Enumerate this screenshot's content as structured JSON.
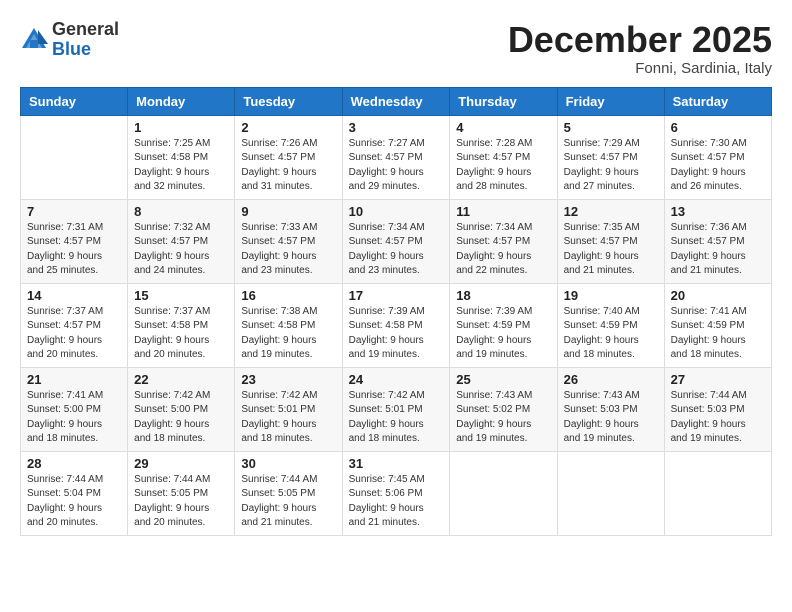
{
  "header": {
    "logo_general": "General",
    "logo_blue": "Blue",
    "title": "December 2025",
    "location": "Fonni, Sardinia, Italy"
  },
  "days_of_week": [
    "Sunday",
    "Monday",
    "Tuesday",
    "Wednesday",
    "Thursday",
    "Friday",
    "Saturday"
  ],
  "weeks": [
    [
      {
        "day": "",
        "info": ""
      },
      {
        "day": "1",
        "info": "Sunrise: 7:25 AM\nSunset: 4:58 PM\nDaylight: 9 hours\nand 32 minutes."
      },
      {
        "day": "2",
        "info": "Sunrise: 7:26 AM\nSunset: 4:57 PM\nDaylight: 9 hours\nand 31 minutes."
      },
      {
        "day": "3",
        "info": "Sunrise: 7:27 AM\nSunset: 4:57 PM\nDaylight: 9 hours\nand 29 minutes."
      },
      {
        "day": "4",
        "info": "Sunrise: 7:28 AM\nSunset: 4:57 PM\nDaylight: 9 hours\nand 28 minutes."
      },
      {
        "day": "5",
        "info": "Sunrise: 7:29 AM\nSunset: 4:57 PM\nDaylight: 9 hours\nand 27 minutes."
      },
      {
        "day": "6",
        "info": "Sunrise: 7:30 AM\nSunset: 4:57 PM\nDaylight: 9 hours\nand 26 minutes."
      }
    ],
    [
      {
        "day": "7",
        "info": "Sunrise: 7:31 AM\nSunset: 4:57 PM\nDaylight: 9 hours\nand 25 minutes."
      },
      {
        "day": "8",
        "info": "Sunrise: 7:32 AM\nSunset: 4:57 PM\nDaylight: 9 hours\nand 24 minutes."
      },
      {
        "day": "9",
        "info": "Sunrise: 7:33 AM\nSunset: 4:57 PM\nDaylight: 9 hours\nand 23 minutes."
      },
      {
        "day": "10",
        "info": "Sunrise: 7:34 AM\nSunset: 4:57 PM\nDaylight: 9 hours\nand 23 minutes."
      },
      {
        "day": "11",
        "info": "Sunrise: 7:34 AM\nSunset: 4:57 PM\nDaylight: 9 hours\nand 22 minutes."
      },
      {
        "day": "12",
        "info": "Sunrise: 7:35 AM\nSunset: 4:57 PM\nDaylight: 9 hours\nand 21 minutes."
      },
      {
        "day": "13",
        "info": "Sunrise: 7:36 AM\nSunset: 4:57 PM\nDaylight: 9 hours\nand 21 minutes."
      }
    ],
    [
      {
        "day": "14",
        "info": "Sunrise: 7:37 AM\nSunset: 4:57 PM\nDaylight: 9 hours\nand 20 minutes."
      },
      {
        "day": "15",
        "info": "Sunrise: 7:37 AM\nSunset: 4:58 PM\nDaylight: 9 hours\nand 20 minutes."
      },
      {
        "day": "16",
        "info": "Sunrise: 7:38 AM\nSunset: 4:58 PM\nDaylight: 9 hours\nand 19 minutes."
      },
      {
        "day": "17",
        "info": "Sunrise: 7:39 AM\nSunset: 4:58 PM\nDaylight: 9 hours\nand 19 minutes."
      },
      {
        "day": "18",
        "info": "Sunrise: 7:39 AM\nSunset: 4:59 PM\nDaylight: 9 hours\nand 19 minutes."
      },
      {
        "day": "19",
        "info": "Sunrise: 7:40 AM\nSunset: 4:59 PM\nDaylight: 9 hours\nand 18 minutes."
      },
      {
        "day": "20",
        "info": "Sunrise: 7:41 AM\nSunset: 4:59 PM\nDaylight: 9 hours\nand 18 minutes."
      }
    ],
    [
      {
        "day": "21",
        "info": "Sunrise: 7:41 AM\nSunset: 5:00 PM\nDaylight: 9 hours\nand 18 minutes."
      },
      {
        "day": "22",
        "info": "Sunrise: 7:42 AM\nSunset: 5:00 PM\nDaylight: 9 hours\nand 18 minutes."
      },
      {
        "day": "23",
        "info": "Sunrise: 7:42 AM\nSunset: 5:01 PM\nDaylight: 9 hours\nand 18 minutes."
      },
      {
        "day": "24",
        "info": "Sunrise: 7:42 AM\nSunset: 5:01 PM\nDaylight: 9 hours\nand 18 minutes."
      },
      {
        "day": "25",
        "info": "Sunrise: 7:43 AM\nSunset: 5:02 PM\nDaylight: 9 hours\nand 19 minutes."
      },
      {
        "day": "26",
        "info": "Sunrise: 7:43 AM\nSunset: 5:03 PM\nDaylight: 9 hours\nand 19 minutes."
      },
      {
        "day": "27",
        "info": "Sunrise: 7:44 AM\nSunset: 5:03 PM\nDaylight: 9 hours\nand 19 minutes."
      }
    ],
    [
      {
        "day": "28",
        "info": "Sunrise: 7:44 AM\nSunset: 5:04 PM\nDaylight: 9 hours\nand 20 minutes."
      },
      {
        "day": "29",
        "info": "Sunrise: 7:44 AM\nSunset: 5:05 PM\nDaylight: 9 hours\nand 20 minutes."
      },
      {
        "day": "30",
        "info": "Sunrise: 7:44 AM\nSunset: 5:05 PM\nDaylight: 9 hours\nand 21 minutes."
      },
      {
        "day": "31",
        "info": "Sunrise: 7:45 AM\nSunset: 5:06 PM\nDaylight: 9 hours\nand 21 minutes."
      },
      {
        "day": "",
        "info": ""
      },
      {
        "day": "",
        "info": ""
      },
      {
        "day": "",
        "info": ""
      }
    ]
  ]
}
